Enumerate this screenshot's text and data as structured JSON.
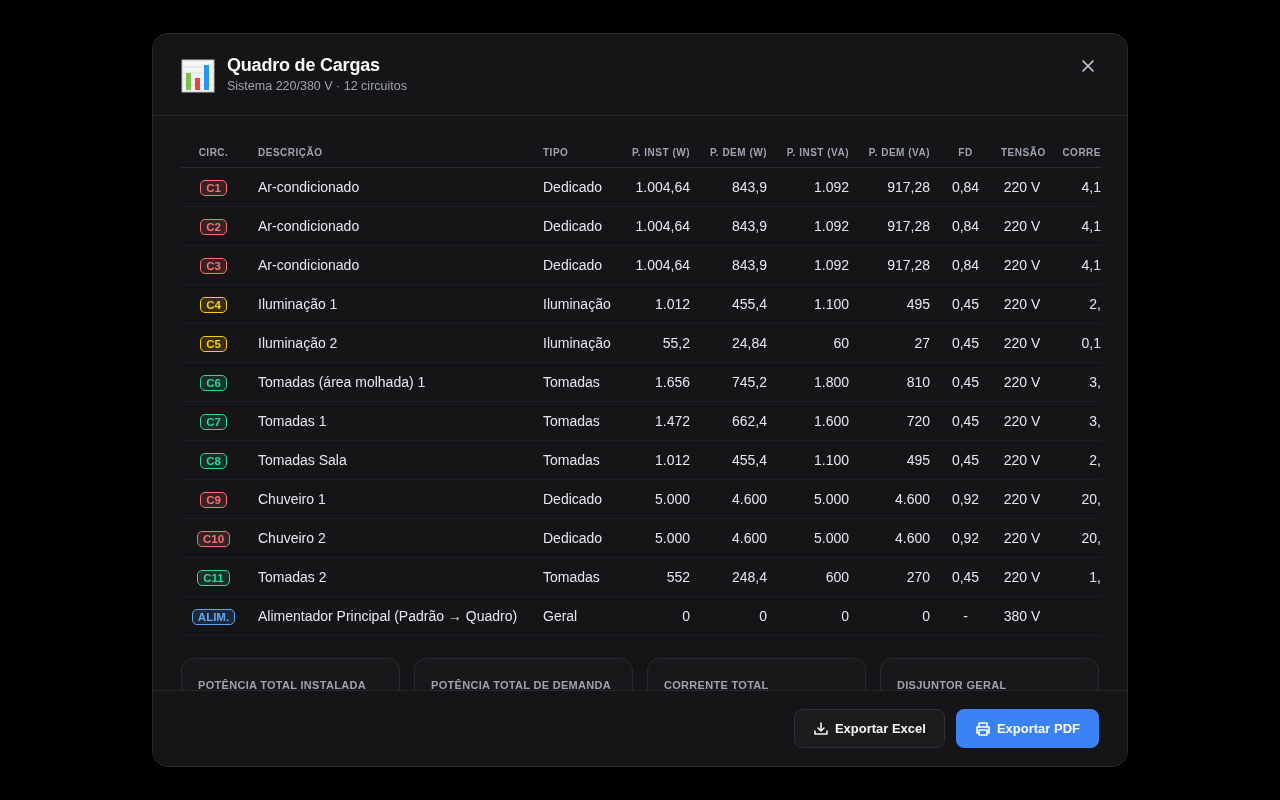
{
  "dialog": {
    "title": "Quadro de Cargas",
    "subtitle": "Sistema 220/380 V · 12 circuitos"
  },
  "table": {
    "columns": [
      "CIRC.",
      "DESCRIÇÃO",
      "TIPO",
      "P. INST (W)",
      "P. DEM (W)",
      "P. INST (VA)",
      "P. DEM (VA)",
      "FD",
      "TENSÃO",
      "CORRE"
    ],
    "rows": [
      {
        "color": "#f87171",
        "cells": [
          "C1",
          "Ar-condicionado",
          "Dedicado",
          "1.004,64",
          "843,9",
          "1.092",
          "917,28",
          "0,84",
          "220 V",
          "4,1"
        ]
      },
      {
        "color": "#f87171",
        "cells": [
          "C2",
          "Ar-condicionado",
          "Dedicado",
          "1.004,64",
          "843,9",
          "1.092",
          "917,28",
          "0,84",
          "220 V",
          "4,1"
        ]
      },
      {
        "color": "#f87171",
        "cells": [
          "C3",
          "Ar-condicionado",
          "Dedicado",
          "1.004,64",
          "843,9",
          "1.092",
          "917,28",
          "0,84",
          "220 V",
          "4,1"
        ]
      },
      {
        "color": "#facc15",
        "cells": [
          "C4",
          "Iluminação 1",
          "Iluminação",
          "1.012",
          "455,4",
          "1.100",
          "495",
          "0,45",
          "220 V",
          "2,"
        ]
      },
      {
        "color": "#facc15",
        "cells": [
          "C5",
          "Iluminação 2",
          "Iluminação",
          "55,2",
          "24,84",
          "60",
          "27",
          "0,45",
          "220 V",
          "0,1"
        ]
      },
      {
        "color": "#34d399",
        "cells": [
          "C6",
          "Tomadas (área molhada) 1",
          "Tomadas",
          "1.656",
          "745,2",
          "1.800",
          "810",
          "0,45",
          "220 V",
          "3,"
        ]
      },
      {
        "color": "#34d399",
        "cells": [
          "C7",
          "Tomadas 1",
          "Tomadas",
          "1.472",
          "662,4",
          "1.600",
          "720",
          "0,45",
          "220 V",
          "3,"
        ]
      },
      {
        "color": "#34d399",
        "cells": [
          "C8",
          "Tomadas Sala",
          "Tomadas",
          "1.012",
          "455,4",
          "1.100",
          "495",
          "0,45",
          "220 V",
          "2,"
        ]
      },
      {
        "color": "#f87171",
        "cells": [
          "C9",
          "Chuveiro 1",
          "Dedicado",
          "5.000",
          "4.600",
          "5.000",
          "4.600",
          "0,92",
          "220 V",
          "20,"
        ]
      },
      {
        "color": "#f87171",
        "cells": [
          "C10",
          "Chuveiro 2",
          "Dedicado",
          "5.000",
          "4.600",
          "5.000",
          "4.600",
          "0,92",
          "220 V",
          "20,"
        ]
      },
      {
        "color": "#34d399",
        "cells": [
          "C11",
          "Tomadas 2",
          "Tomadas",
          "552",
          "248,4",
          "600",
          "270",
          "0,45",
          "220 V",
          "1,"
        ]
      },
      {
        "color": "#60a5fa",
        "cells": [
          "ALIM.",
          "Alimentador Principal (Padrão → Quadro)",
          "Geral",
          "0",
          "0",
          "0",
          "0",
          "-",
          "380 V",
          ""
        ]
      }
    ]
  },
  "summary_cards": [
    {
      "label": "POTÊNCIA TOTAL INSTALADA"
    },
    {
      "label": "POTÊNCIA TOTAL DE DEMANDA"
    },
    {
      "label": "CORRENTE TOTAL"
    },
    {
      "label": "DISJUNTOR GERAL"
    }
  ],
  "buttons": [
    {
      "label": "Exportar Excel",
      "kind": "download"
    },
    {
      "label": "Exportar PDF",
      "kind": "print"
    }
  ]
}
